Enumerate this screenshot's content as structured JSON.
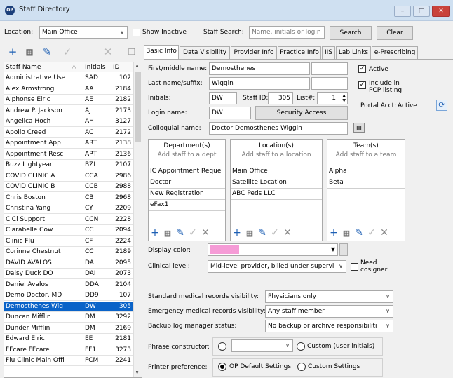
{
  "window": {
    "title": "Staff Directory",
    "icon_text": "OP",
    "min": "–",
    "max": "□",
    "close": "✕"
  },
  "filter": {
    "location_label": "Location:",
    "location_value": "Main Office",
    "show_inactive_label": "Show Inactive",
    "search_label": "Staff Search:",
    "search_placeholder": "Name, initials or login",
    "search_button": "Search",
    "clear_button": "Clear"
  },
  "toolbar": {
    "add": "+",
    "delete": "🗑",
    "edit": "✎",
    "ok": "✓",
    "cancel": "✕",
    "copy": "❐"
  },
  "staff_list": {
    "columns": [
      "Staff Name",
      "Initials",
      "ID"
    ],
    "sort_icon": "△",
    "rows": [
      {
        "name": "Administrative Use",
        "initials": "SAD",
        "id": "102"
      },
      {
        "name": "Alex Armstrong",
        "initials": "AA",
        "id": "2184"
      },
      {
        "name": "Alphonse Elric",
        "initials": "AE",
        "id": "2182"
      },
      {
        "name": "Andrew P. Jackson",
        "initials": "AJ",
        "id": "2173"
      },
      {
        "name": "Angelica Hoch",
        "initials": "AH",
        "id": "3127"
      },
      {
        "name": "Apollo Creed",
        "initials": "AC",
        "id": "2172"
      },
      {
        "name": "Appointment App",
        "initials": "ART",
        "id": "2138"
      },
      {
        "name": "Appointment Resc",
        "initials": "APT",
        "id": "2136"
      },
      {
        "name": "Buzz Lightyear",
        "initials": "BZL",
        "id": "2107"
      },
      {
        "name": "COVID CLINIC A",
        "initials": "CCA",
        "id": "2986"
      },
      {
        "name": "COVID CLINIC B",
        "initials": "CCB",
        "id": "2988"
      },
      {
        "name": "Chris Boston",
        "initials": "CB",
        "id": "2968"
      },
      {
        "name": "Christina  Yang",
        "initials": "CY",
        "id": "2209"
      },
      {
        "name": "CiCi Support",
        "initials": "CCN",
        "id": "2228"
      },
      {
        "name": "Clarabelle Cow",
        "initials": "CC",
        "id": "2094"
      },
      {
        "name": "Clinic Flu",
        "initials": "CF",
        "id": "2224"
      },
      {
        "name": "Corinne Chestnut",
        "initials": "CC",
        "id": "2189"
      },
      {
        "name": "DAVID AVALOS",
        "initials": "DA",
        "id": "2095"
      },
      {
        "name": "Daisy Duck DO",
        "initials": "DAI",
        "id": "2073"
      },
      {
        "name": "Daniel Avalos",
        "initials": "DDA",
        "id": "2104"
      },
      {
        "name": "Demo Doctor, MD",
        "initials": "DD9",
        "id": "107"
      },
      {
        "name": "Demosthenes Wig",
        "initials": "DW",
        "id": "305"
      },
      {
        "name": "Duncan Mifflin",
        "initials": "DM",
        "id": "3292"
      },
      {
        "name": "Dunder Mifflin",
        "initials": "DM",
        "id": "2169"
      },
      {
        "name": "Edward Elric",
        "initials": "EE",
        "id": "2181"
      },
      {
        "name": "FFcare FFcare",
        "initials": "FF1",
        "id": "3273"
      },
      {
        "name": "Flu Clinic Main Offi",
        "initials": "FCM",
        "id": "2241"
      }
    ],
    "selected_index": 21
  },
  "tabs": [
    "Basic Info",
    "Data Visibility",
    "Provider Info",
    "Practice Info",
    "IIS",
    "Lab Links",
    "e-Prescribing"
  ],
  "basic": {
    "first_label": "First/middle name:",
    "first_value": "Demosthenes",
    "last_label": "Last name/suffix:",
    "last_value": "Wiggin",
    "initials_label": "Initials:",
    "initials_value": "DW",
    "staffid_label": "Staff ID:",
    "staffid_value": "305",
    "listno_label": "List#:",
    "listno_value": "1",
    "login_label": "Login name:",
    "login_value": "DW",
    "security_button": "Security Access",
    "colloquial_label": "Colloquial name:",
    "colloquial_value": "Doctor Demosthenes Wiggin",
    "active_label": "Active",
    "pcp_label": "Include in PCP listing",
    "portal_label": "Portal Acct:",
    "portal_value": "Active"
  },
  "departments": {
    "title": "Department(s)",
    "hint": "Add staff to a dept",
    "items": [
      "IC Appointment Reque",
      "Doctor",
      "New Registration",
      "eFax1"
    ]
  },
  "locations": {
    "title": "Location(s)",
    "hint": "Add staff to a location",
    "items": [
      "Main Office",
      "Satellite Location",
      "ABC Peds LLC"
    ]
  },
  "teams": {
    "title": "Team(s)",
    "hint": "Add staff to a team",
    "items": [
      "Alpha",
      "Beta"
    ]
  },
  "display": {
    "color_label": "Display color:",
    "color_value": "#f59bd6",
    "more": "…"
  },
  "clinical": {
    "label": "Clinical level:",
    "value": "Mid-level provider, billed under supervi",
    "need_label": "Need cosigner"
  },
  "visibility": {
    "standard_label": "Standard medical records visibility:",
    "standard_value": "Physicians only",
    "emergency_label": "Emergency medical records visibility:",
    "emergency_value": "Any staff member",
    "backup_label": "Backup log manager status:",
    "backup_value": "No backup or archive responsibiliti"
  },
  "phrase": {
    "label": "Phrase constructor:",
    "custom_label": "Custom (user initials)"
  },
  "printer": {
    "label": "Printer preference:",
    "op_label": "OP Default Settings",
    "custom_label": "Custom Settings"
  }
}
